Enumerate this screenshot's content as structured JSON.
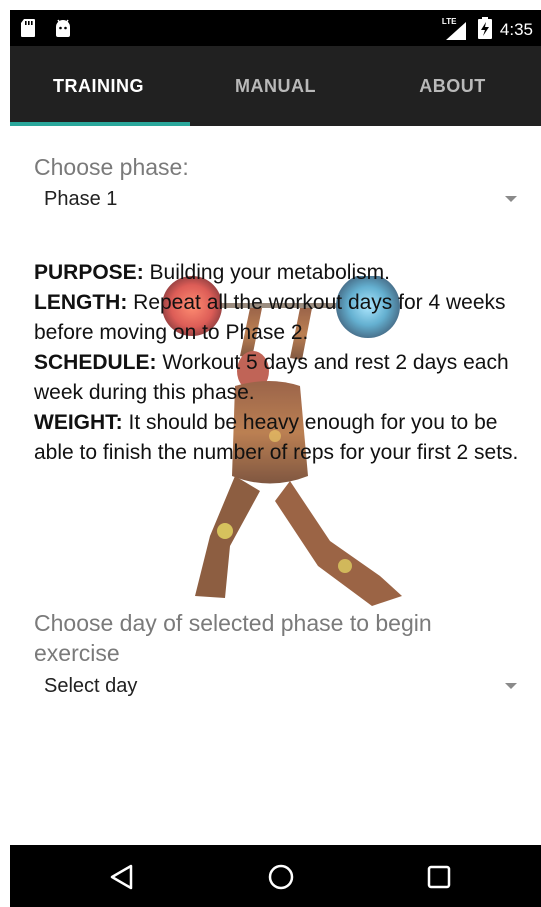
{
  "status_bar": {
    "time": "4:35",
    "network_label": "LTE",
    "icons": [
      "sd-card-icon",
      "android-icon",
      "lte-signal-icon",
      "battery-charging-icon"
    ]
  },
  "tabs": [
    {
      "label": "TRAINING",
      "active": true
    },
    {
      "label": "MANUAL",
      "active": false
    },
    {
      "label": "ABOUT",
      "active": false
    }
  ],
  "phase": {
    "label": "Choose phase:",
    "selected": "Phase 1"
  },
  "info": {
    "purpose_title": "PURPOSE:",
    "purpose_text": " Building your metabolism.",
    "length_title": "LENGTH:",
    "length_text": " Repeat all the workout days for 4 weeks before moving on to Phase 2.",
    "schedule_title": "SCHEDULE:",
    "schedule_text": " Workout 5 days and rest 2 days each week during this phase.",
    "weight_title": "WEIGHT:",
    "weight_text": " It should be heavy enough for you to be able to finish the number of reps for your first 2 sets."
  },
  "day": {
    "label": "Choose day of selected phase to begin exercise",
    "selected": "Select day"
  },
  "colors": {
    "accent": "#2aa79b",
    "toolbar": "#212121",
    "statusbar": "#000000"
  }
}
